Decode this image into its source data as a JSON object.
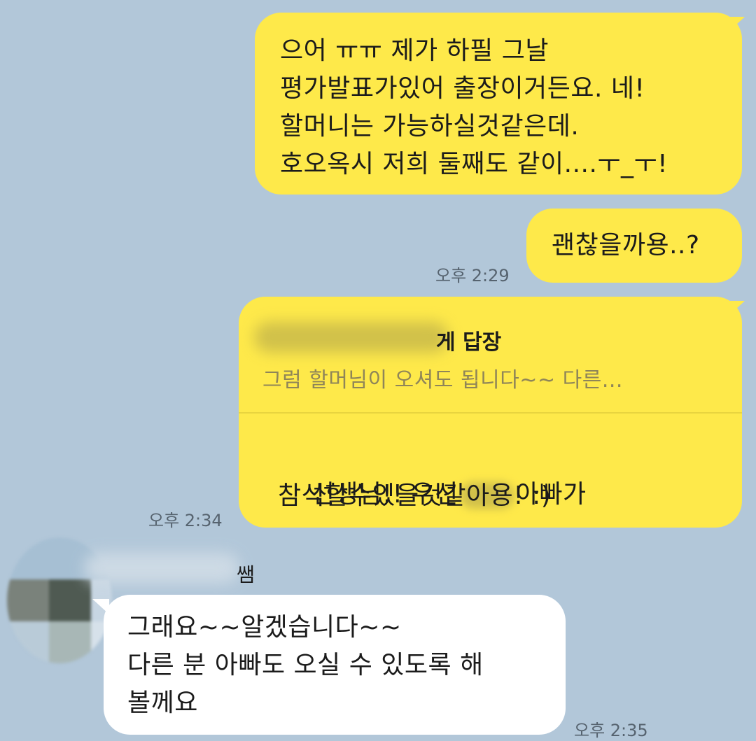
{
  "colors": {
    "background": "#b2c7d9",
    "my_bubble": "#fee94a",
    "other_bubble": "#ffffff",
    "timestamp": "#56636f"
  },
  "messages": {
    "m1": {
      "text": "으어 ㅠㅠ 제가 하필 그날\n평가발표가있어 출장이거든요. 네!\n할머니는 가능하실것같은데.\n호오옥시 저희 둘째도 같이....ㅜ_ㅜ!"
    },
    "m2": {
      "text": "괜찮을까용..?",
      "time": "오후 2:29"
    },
    "m3": {
      "reply_header_visible": "게 답장",
      "reply_preview": "그럼 할머님이 오셔도 됩니다~~ 다른...",
      "text_line1_prefix": "선생님!! 우선",
      "text_line1_suffix": "아빠가",
      "text_line2": "참석할수있을것같아용! :)",
      "time": "오후 2:34"
    },
    "m4": {
      "sender_visible": "쌤",
      "text": "그래요~~알겠습니다~~\n다른 분 아빠도 오실 수 있도록 해\n볼께요",
      "time": "오후 2:35"
    }
  }
}
